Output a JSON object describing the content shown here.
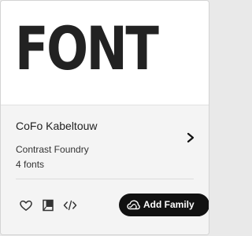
{
  "card": {
    "preview_text": "FONT",
    "family_name": "CoFo Kabeltouw",
    "foundry": "Contrast Foundry",
    "font_count": "4 fonts",
    "add_family_label": "Add Family"
  },
  "icons": {
    "favorite": "heart-icon",
    "details": "chevron-right-icon",
    "sample": "book-icon",
    "embed": "code-icon",
    "creative_cloud": "creative-cloud-icon"
  },
  "colors": {
    "preview_background": "#ffffff",
    "details_background": "#f4f4f4",
    "text_primary": "#222222",
    "button_background": "#111111",
    "button_text": "#ffffff"
  }
}
